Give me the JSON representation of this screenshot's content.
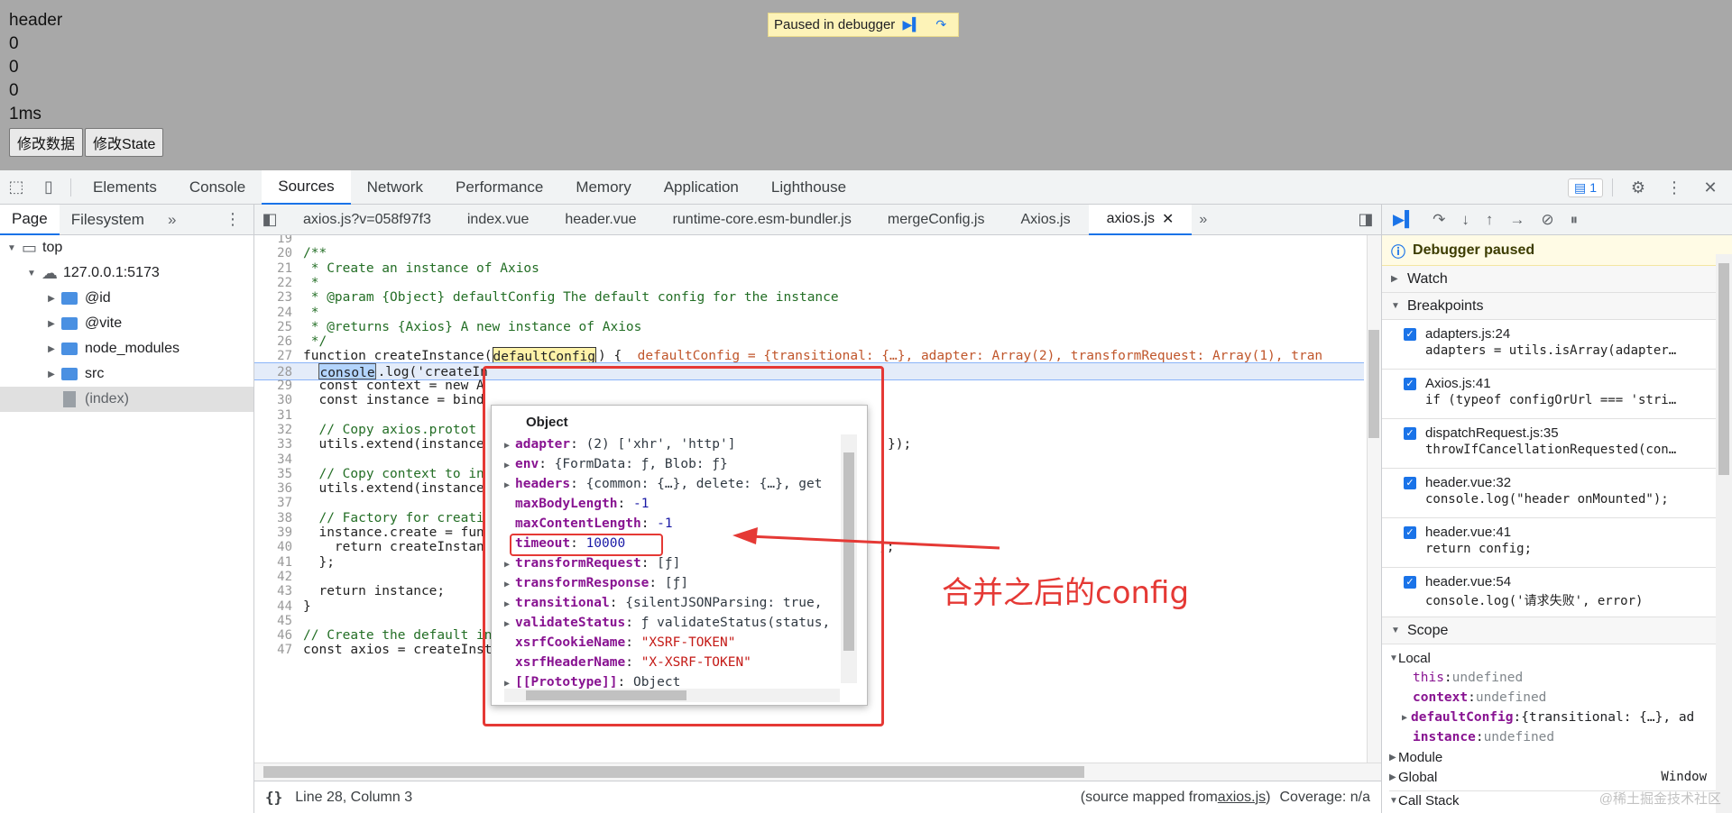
{
  "page": {
    "lines": [
      "header",
      "0",
      "0",
      "0",
      "1ms"
    ],
    "buttons": [
      "修改数据",
      "修改State"
    ],
    "paused_banner": "Paused in debugger"
  },
  "devtools": {
    "tabs": [
      "Elements",
      "Console",
      "Sources",
      "Network",
      "Performance",
      "Memory",
      "Application",
      "Lighthouse"
    ],
    "active_tab": "Sources",
    "issues_count": "1"
  },
  "navigator": {
    "tabs": [
      "Page",
      "Filesystem"
    ],
    "tree": [
      {
        "label": "top",
        "level": 0,
        "type": "frame",
        "expanded": true
      },
      {
        "label": "127.0.0.1:5173",
        "level": 1,
        "type": "cloud",
        "expanded": true
      },
      {
        "label": "@id",
        "level": 2,
        "type": "folder"
      },
      {
        "label": "@vite",
        "level": 2,
        "type": "folder"
      },
      {
        "label": "node_modules",
        "level": 2,
        "type": "folder"
      },
      {
        "label": "src",
        "level": 2,
        "type": "folder"
      },
      {
        "label": "(index)",
        "level": 2,
        "type": "file",
        "selected": true
      }
    ]
  },
  "editor": {
    "tabs": [
      "axios.js?v=058f97f3",
      "index.vue",
      "header.vue",
      "runtime-core.esm-bundler.js",
      "mergeConfig.js",
      "Axios.js",
      "axios.js"
    ],
    "active_tab": "axios.js",
    "lines": [
      {
        "n": "19",
        "text": ""
      },
      {
        "n": "20",
        "text": "/**",
        "cls": "comment"
      },
      {
        "n": "21",
        "text": " * Create an instance of Axios",
        "cls": "comment"
      },
      {
        "n": "22",
        "text": " *",
        "cls": "comment"
      },
      {
        "n": "23",
        "text": " * @param {Object} defaultConfig The default config for the instance",
        "cls": "comment"
      },
      {
        "n": "24",
        "text": " *",
        "cls": "comment"
      },
      {
        "n": "25",
        "text": " * @returns {Axios} A new instance of Axios",
        "cls": "comment"
      },
      {
        "n": "26",
        "text": " */",
        "cls": "comment"
      },
      {
        "n": "27",
        "text": "function createInstance(",
        "hl": "defaultConfig",
        "rest": ") {  ",
        "inline": "defaultConfig = {transitional: {…}, adapter: Array(2), transformRequest: Array(1), tran"
      },
      {
        "n": "28",
        "text": "  ",
        "hl2": "console",
        "rest": ".log('createIn",
        "exec": true
      },
      {
        "n": "29",
        "text": "  const context = new A"
      },
      {
        "n": "30",
        "text": "  const instance = bind"
      },
      {
        "n": "31",
        "text": ""
      },
      {
        "n": "32",
        "text": "  // Copy axios.protot",
        "cls": "comment"
      },
      {
        "n": "33",
        "text": "  utils.extend(instance",
        "tail": "});"
      },
      {
        "n": "34",
        "text": ""
      },
      {
        "n": "35",
        "text": "  // Copy context to in",
        "cls": "comment"
      },
      {
        "n": "36",
        "text": "  utils.extend(instance"
      },
      {
        "n": "37",
        "text": ""
      },
      {
        "n": "38",
        "text": "  // Factory for creati",
        "cls": "comment"
      },
      {
        "n": "39",
        "text": "  instance.create = fun"
      },
      {
        "n": "40",
        "text": "    return createInstan",
        "tail": ");"
      },
      {
        "n": "41",
        "text": "  };"
      },
      {
        "n": "42",
        "text": ""
      },
      {
        "n": "43",
        "text": "  return instance;"
      },
      {
        "n": "44",
        "text": "}"
      },
      {
        "n": "45",
        "text": ""
      },
      {
        "n": "46",
        "text": "// Create the default instance to be exported",
        "cls": "comment"
      },
      {
        "n": "47",
        "text": "const axios = createInstance(defaults);"
      }
    ]
  },
  "status_bar": {
    "braces": "{}",
    "position": "Line 28, Column 3",
    "source_mapped": "(source mapped from ",
    "source_link": "axios.js",
    "source_close": ")",
    "coverage": "Coverage: n/a"
  },
  "popover": {
    "title": "Object",
    "rows": [
      {
        "expand": true,
        "key": "adapter",
        "sep": ": ",
        "val": "(2) ['xhr', 'http']",
        "type": "obj"
      },
      {
        "expand": true,
        "key": "env",
        "sep": ": ",
        "val": "{FormData: ƒ, Blob: ƒ}",
        "type": "obj"
      },
      {
        "expand": true,
        "key": "headers",
        "sep": ": ",
        "val": "{common: {…}, delete: {…}, get",
        "type": "obj"
      },
      {
        "expand": false,
        "key": "maxBodyLength",
        "sep": ": ",
        "val": "-1",
        "type": "num"
      },
      {
        "expand": false,
        "key": "maxContentLength",
        "sep": ": ",
        "val": "-1",
        "type": "num"
      },
      {
        "expand": false,
        "key": "timeout",
        "sep": ": ",
        "val": "10000",
        "type": "num"
      },
      {
        "expand": true,
        "key": "transformRequest",
        "sep": ": ",
        "val": "[ƒ]",
        "type": "obj"
      },
      {
        "expand": true,
        "key": "transformResponse",
        "sep": ": ",
        "val": "[ƒ]",
        "type": "obj"
      },
      {
        "expand": true,
        "key": "transitional",
        "sep": ": ",
        "val": "{silentJSONParsing: true,",
        "type": "obj"
      },
      {
        "expand": true,
        "key": "validateStatus",
        "sep": ": ",
        "val": "ƒ validateStatus(status,",
        "type": "obj"
      },
      {
        "expand": false,
        "key": "xsrfCookieName",
        "sep": ": ",
        "val": "\"XSRF-TOKEN\"",
        "type": "str"
      },
      {
        "expand": false,
        "key": "xsrfHeaderName",
        "sep": ": ",
        "val": "\"X-XSRF-TOKEN\"",
        "type": "str"
      },
      {
        "expand": true,
        "key": "[[Prototype]]",
        "sep": ": ",
        "val": "Object",
        "type": "obj"
      }
    ]
  },
  "annotation": {
    "text": "合并之后的config",
    "color": "#e53935"
  },
  "debugger": {
    "paused_label": "Debugger paused",
    "sections": {
      "watch": "Watch",
      "breakpoints": "Breakpoints",
      "scope": "Scope",
      "callstack": "Call Stack"
    },
    "breakpoints": [
      {
        "loc": "adapters.js:24",
        "code": "adapters = utils.isArray(adapter…"
      },
      {
        "loc": "Axios.js:41",
        "code": "if (typeof configOrUrl === 'stri…"
      },
      {
        "loc": "dispatchRequest.js:35",
        "code": "throwIfCancellationRequested(con…"
      },
      {
        "loc": "header.vue:32",
        "code": "console.log(\"header onMounted\");"
      },
      {
        "loc": "header.vue:41",
        "code": "return config;"
      },
      {
        "loc": "header.vue:54",
        "code": "console.log('请求失败', error)"
      }
    ],
    "scope": {
      "local_label": "Local",
      "vars": [
        {
          "key": "this",
          "val": "undefined",
          "bold": false,
          "expand": false
        },
        {
          "key": "context",
          "val": "undefined",
          "bold": true,
          "expand": false
        },
        {
          "key": "defaultConfig",
          "val": "{transitional: {…}, ad",
          "bold": true,
          "expand": true
        },
        {
          "key": "instance",
          "val": "undefined",
          "bold": true,
          "expand": false
        }
      ],
      "module_label": "Module",
      "global_label": "Global",
      "global_value": "Window"
    }
  },
  "watermark": "@稀土掘金技术社区"
}
